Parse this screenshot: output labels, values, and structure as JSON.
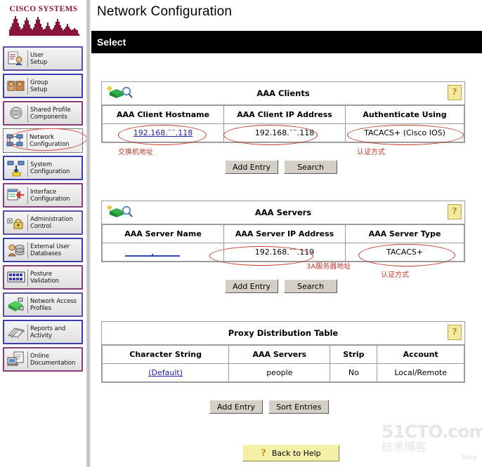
{
  "brand": {
    "line1": "CISCO SYSTEMS",
    "logo_color": "#8a1538"
  },
  "header": {
    "title": "Network Configuration",
    "select_bar_label": "Select"
  },
  "sidebar": {
    "items": [
      {
        "label": "User\nSetup",
        "icon": "user-setup-icon"
      },
      {
        "label": "Group\nSetup",
        "icon": "group-setup-icon"
      },
      {
        "label": "Shared Profile\nComponents",
        "icon": "shared-profile-icon"
      },
      {
        "label": "Network\nConfiguration",
        "icon": "network-configuration-icon"
      },
      {
        "label": "System\nConfiguration",
        "icon": "system-configuration-icon"
      },
      {
        "label": "Interface\nConfiguration",
        "icon": "interface-configuration-icon"
      },
      {
        "label": "Administration\nControl",
        "icon": "administration-control-icon"
      },
      {
        "label": "External User\nDatabases",
        "icon": "external-user-databases-icon"
      },
      {
        "label": "Posture\nValidation",
        "icon": "posture-validation-icon"
      },
      {
        "label": "Network Access\nProfiles",
        "icon": "network-access-profiles-icon"
      },
      {
        "label": "Reports and\nActivity",
        "icon": "reports-activity-icon"
      },
      {
        "label": "Online\nDocumentation",
        "icon": "online-documentation-icon"
      }
    ],
    "selected_index": 3
  },
  "aaa_clients": {
    "title": "AAA Clients",
    "help_label": "?",
    "columns": [
      "AAA Client Hostname",
      "AAA Client IP Address",
      "Authenticate Using"
    ],
    "rows": [
      {
        "hostname": "192.168.¨¨.118",
        "ip_address": "192.168.¨¨.118",
        "authenticate_using": "TACACS+ (Cisco IOS)"
      }
    ],
    "buttons": [
      "Add Entry",
      "Search"
    ],
    "annotations": [
      {
        "text": "交换机地址"
      },
      {
        "text": "认证方式"
      }
    ]
  },
  "aaa_servers": {
    "title": "AAA Servers",
    "help_label": "?",
    "columns": [
      "AAA Server Name",
      "AAA Server IP Address",
      "AAA Server Type"
    ],
    "rows": [
      {
        "server_name": "",
        "ip_address": "192.168.¨¨.119",
        "server_type": "TACACS+"
      }
    ],
    "buttons": [
      "Add Entry",
      "Search"
    ],
    "annotations": [
      {
        "text": "3A服务器地址"
      },
      {
        "text": "认证方式"
      }
    ]
  },
  "proxy_distribution": {
    "title": "Proxy Distribution Table",
    "help_label": "?",
    "columns": [
      "Character String",
      "AAA Servers",
      "Strip",
      "Account"
    ],
    "rows": [
      {
        "character_string": "(Default)",
        "aaa_servers": "people",
        "strip": "No",
        "account": "Local/Remote"
      }
    ],
    "buttons": [
      "Add Entry",
      "Sort Entries"
    ]
  },
  "footer": {
    "back_to_help": "Back to Help",
    "help_icon": "?"
  },
  "watermark": {
    "line1": "51CTO.com",
    "line2": "技术博客",
    "line3": "Blog"
  }
}
